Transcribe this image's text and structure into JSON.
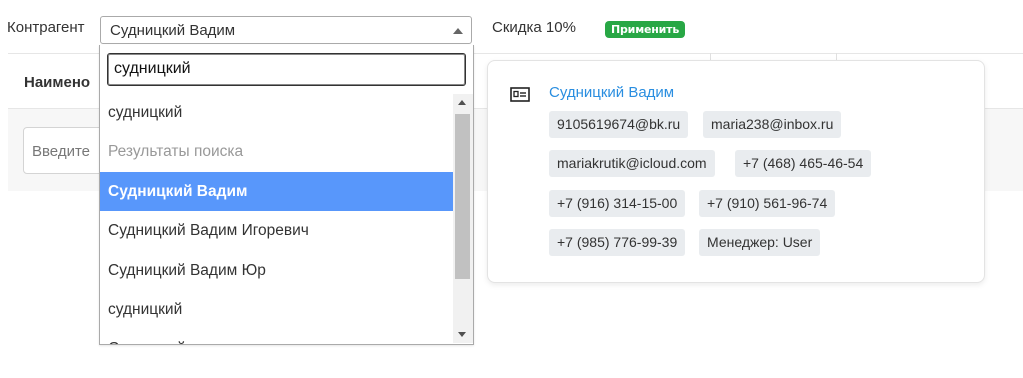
{
  "filters": {
    "contragent_label": "Контрагент",
    "contragent_value": "Судницкий Вадим",
    "discount_text": "Скидка 10%",
    "apply_label": "Применить"
  },
  "table": {
    "col_name_header": "Наимено",
    "filter_placeholder": "Введите"
  },
  "dropdown": {
    "search_value": "судницкий",
    "items": [
      {
        "label": "судницкий",
        "type": "option"
      },
      {
        "label": "Результаты поиска",
        "type": "group"
      },
      {
        "label": "Судницкий Вадим",
        "type": "option",
        "active": true
      },
      {
        "label": "Судницкий Вадим Игоревич",
        "type": "option"
      },
      {
        "label": "Судницкий Вадим Юр",
        "type": "option"
      },
      {
        "label": "судницкий",
        "type": "option"
      },
      {
        "label": "Судницкий",
        "type": "option"
      }
    ]
  },
  "card": {
    "icon": "contact-card-icon",
    "name": "Судницкий Вадим",
    "chips": [
      "9105619674@bk.ru",
      "maria238@inbox.ru",
      "mariakrutik@icloud.com",
      "+7 (468) 465-46-54",
      "+7 (916) 314-15-00",
      "+7 (910) 561-96-74",
      "+7 (985) 776-99-39",
      "Менеджер: User"
    ]
  },
  "colors": {
    "accent": "#5897fb",
    "apply_green": "#28a745",
    "link_blue": "#2a8ee0"
  }
}
